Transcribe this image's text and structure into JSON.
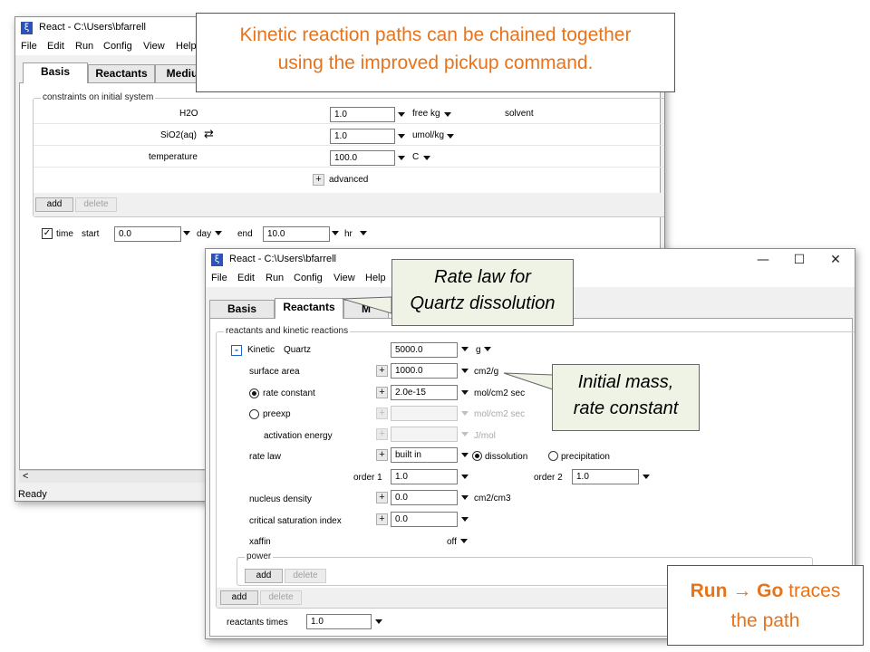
{
  "back_window": {
    "title": "React - C:\\Users\\bfarrell",
    "menu": [
      "File",
      "Edit",
      "Run",
      "Config",
      "View",
      "Help"
    ],
    "tabs": [
      "Basis",
      "Reactants",
      "Mediu"
    ],
    "group_label": "constraints on initial system",
    "rows": [
      {
        "name": "H2O",
        "value": "1.0",
        "unit": "free kg",
        "note": "solvent"
      },
      {
        "name": "SiO2(aq)",
        "value": "1.0",
        "unit": "umol/kg",
        "note": ""
      },
      {
        "name": "temperature",
        "value": "100.0",
        "unit": "C",
        "note": ""
      }
    ],
    "advanced_label": "advanced",
    "add_label": "add",
    "delete_label": "delete",
    "time": {
      "label": "time",
      "start_label": "start",
      "start_value": "0.0",
      "start_unit": "day",
      "end_label": "end",
      "end_value": "10.0",
      "end_unit": "hr",
      "checked": "✓"
    },
    "scroll_left": "<",
    "status": "Ready"
  },
  "front_window": {
    "title": "React - C:\\Users\\bfarrell",
    "controls": {
      "minimize": "—",
      "maximize": "☐",
      "close": "✕"
    },
    "menu": [
      "File",
      "Edit",
      "Run",
      "Config",
      "View",
      "Help"
    ],
    "tabs": [
      "Basis",
      "Reactants",
      "M"
    ],
    "group_label": "reactants and kinetic reactions",
    "kinetic": {
      "label": "Kinetic",
      "mineral": "Quartz",
      "value": "5000.0",
      "unit": "g"
    },
    "surface_area": {
      "label": "surface area",
      "value": "1000.0",
      "unit": "cm2/g"
    },
    "rate_constant": {
      "label": "rate constant",
      "value": "2.0e-15",
      "unit": "mol/cm2 sec"
    },
    "preexp": {
      "label": "preexp",
      "value": "",
      "unit": "mol/cm2 sec"
    },
    "activation_energy": {
      "label": "activation energy",
      "value": "",
      "unit": "J/mol"
    },
    "rate_law": {
      "label": "rate law",
      "value": "built in",
      "dissolution": "dissolution",
      "precipitation": "precipitation"
    },
    "order1": {
      "label": "order 1",
      "value": "1.0"
    },
    "order2": {
      "label": "order 2",
      "value": "1.0"
    },
    "nucleus_density": {
      "label": "nucleus density",
      "value": "0.0",
      "unit": "cm2/cm3"
    },
    "critical_saturation": {
      "label": "critical saturation index",
      "value": "0.0"
    },
    "xaffin": {
      "label": "xaffin",
      "value": "off"
    },
    "power": {
      "label": "power",
      "add": "add",
      "delete": "delete"
    },
    "add_label": "add",
    "delete_label": "delete",
    "reactants_times": {
      "label": "reactants times",
      "value": "1.0"
    }
  },
  "callouts": {
    "top_line1": "Kinetic reaction paths can be chained together",
    "top_line2": "using the improved pickup command.",
    "rate_law_line1": "Rate law for",
    "rate_law_line2": "Quartz dissolution",
    "initial_line1": "Initial mass,",
    "initial_line2": "rate constant",
    "run_bold1": "Run",
    "run_arrow": "→",
    "run_bold2": "Go",
    "run_rest1": "traces",
    "run_rest2": "the path"
  },
  "colors": {
    "callout_text": "#e8731a",
    "callout_green_bg": "#eff3e5",
    "minus_blue": "#1d63c9"
  }
}
